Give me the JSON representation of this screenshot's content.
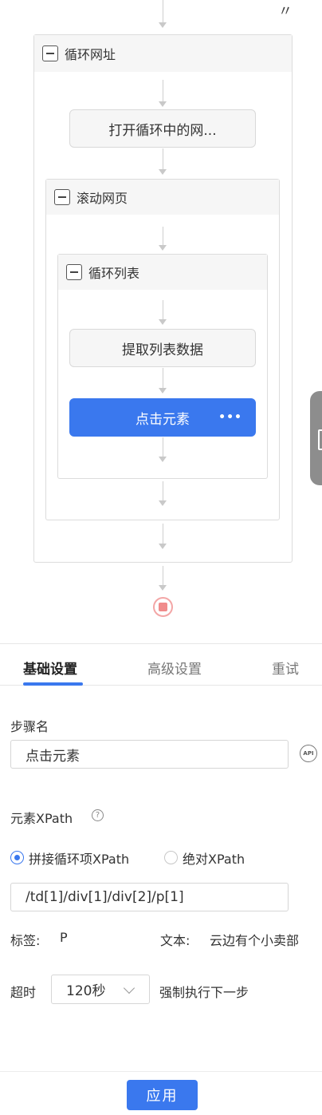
{
  "flow": {
    "top_mark": "〃",
    "loop_url": {
      "title": "循环网址"
    },
    "open_page_node": "打开循环中的网...",
    "scroll": {
      "title": "滚动网页"
    },
    "loop_list": {
      "title": "循环列表"
    },
    "extract_node": "提取列表数据",
    "click_node": {
      "label": "点击元素",
      "more": "•••"
    }
  },
  "panel": {
    "tabs": [
      {
        "label": "基础设置",
        "active": true
      },
      {
        "label": "高级设置",
        "active": false
      },
      {
        "label": "重试",
        "active": false
      }
    ],
    "step_name_label": "步骤名",
    "step_name_value": "点击元素",
    "api_icon_text": "API",
    "xpath_label": "元素XPath",
    "help_icon_text": "?",
    "radio_options": [
      {
        "label": "拼接循环项XPath",
        "checked": true
      },
      {
        "label": "绝对XPath",
        "checked": false
      }
    ],
    "xpath_value": "/td[1]/div[1]/div[2]/p[1]",
    "tag_label": "标签:",
    "tag_value": "P",
    "text_label": "文本:",
    "text_value": "云边有个小卖部",
    "timeout_label": "超时",
    "timeout_value": "120秒",
    "force_next_label": "强制执行下一步",
    "apply_button": "应用"
  },
  "colors": {
    "accent": "#3a78ee",
    "end_node": "#f08c8c",
    "group_header": "#f6f6f6"
  }
}
